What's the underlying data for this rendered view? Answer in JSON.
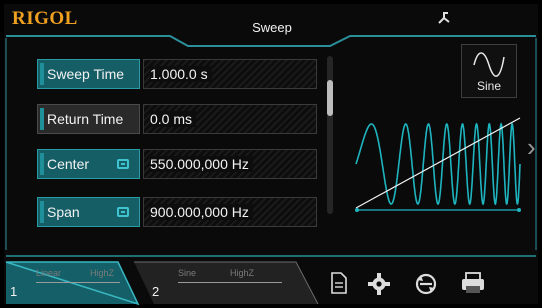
{
  "header": {
    "logo": "RIGOL",
    "title": "Sweep",
    "usb_icon": "usb-icon"
  },
  "params": [
    {
      "label": "Sweep Time",
      "value": "1.000.0 s",
      "active": true
    },
    {
      "label": "Return Time",
      "value": "0.0 ms",
      "active": false
    },
    {
      "label": "Center",
      "value": "550.000,000 Hz",
      "active": true,
      "linked": true
    },
    {
      "label": "Span",
      "value": "900.000,000 Hz",
      "active": true,
      "linked": true
    }
  ],
  "scroll": {
    "position": 0.25
  },
  "waveform": {
    "label": "Sine",
    "icon": "sine-wave-icon"
  },
  "channels": [
    {
      "number": "1",
      "mode": "Linear",
      "load": "HighZ",
      "active": true
    },
    {
      "number": "2",
      "mode": "Sine",
      "load": "HighZ",
      "active": false
    }
  ],
  "toolbar": {
    "icons": [
      "document-icon",
      "gear-icon",
      "refresh-icon",
      "printer-icon"
    ]
  },
  "colors": {
    "accent": "#1f8f9a",
    "logo": "#f0a020",
    "wave": "#1fb5c0"
  }
}
